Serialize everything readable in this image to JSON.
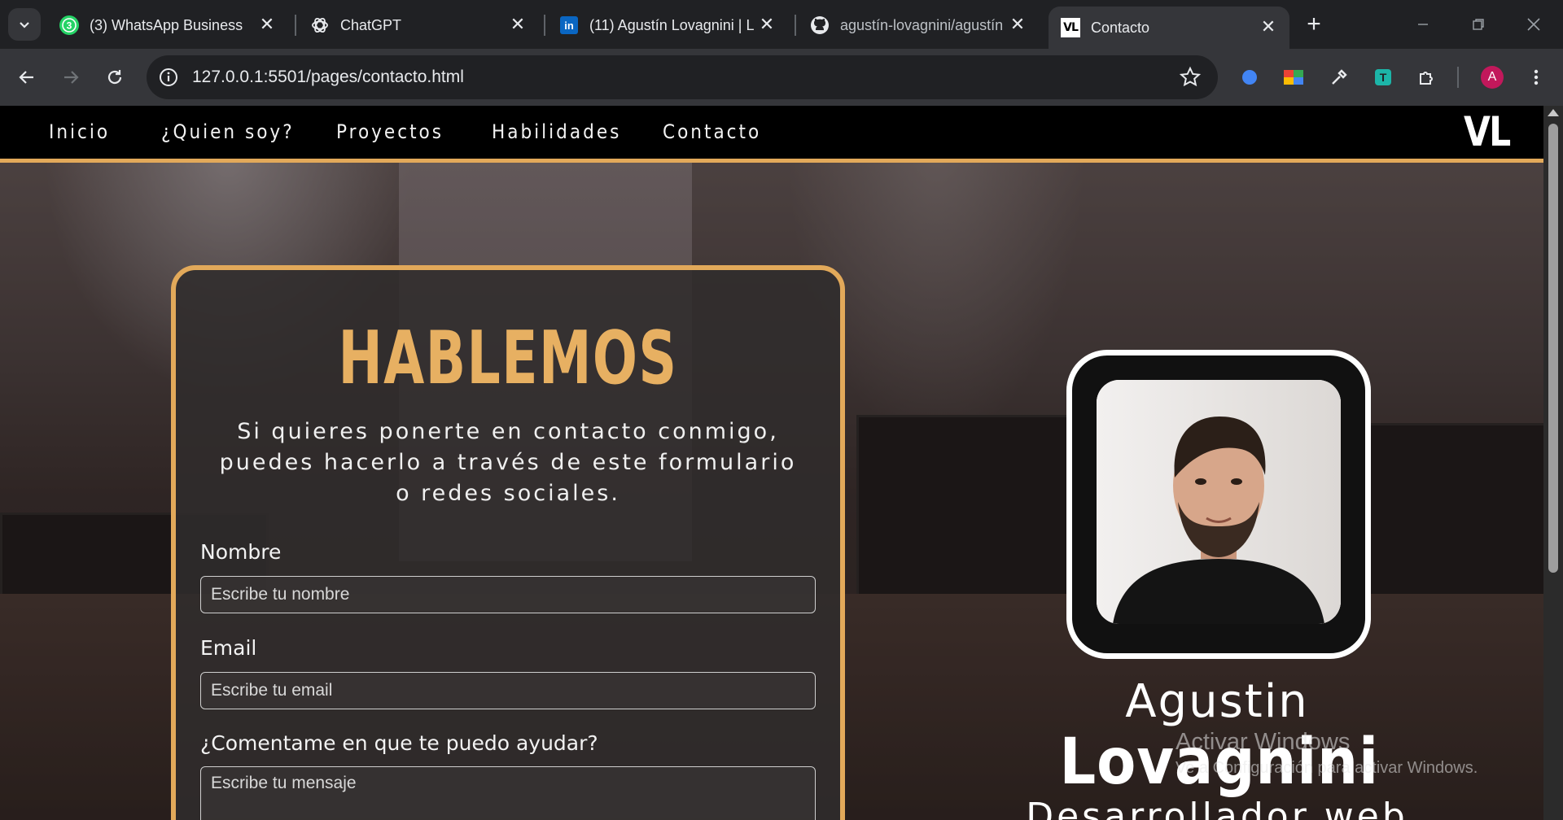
{
  "browser": {
    "tabs": [
      {
        "title": "(3) WhatsApp Business",
        "icon": "whatsapp-icon",
        "badge": "3"
      },
      {
        "title": "ChatGPT",
        "icon": "chatgpt-icon"
      },
      {
        "title": "(11) Agustín Lovagnini | L",
        "icon": "linkedin-icon"
      },
      {
        "title": "agustín-lovagnini/agustín",
        "icon": "github-icon"
      },
      {
        "title": "Contacto",
        "icon": "vl-favicon-icon",
        "favicon_text": "VL",
        "active": true
      }
    ],
    "url": "127.0.0.1:5501/pages/contacto.html",
    "profile_initial": "A"
  },
  "site": {
    "nav": [
      "Inicio",
      "¿Quien soy?",
      "Proyectos",
      "Habilidades",
      "Contacto"
    ],
    "logo": "VL",
    "accent": "#e2a95a"
  },
  "contact": {
    "heading": "HABLEMOS",
    "intro": "Si quieres ponerte en contacto conmigo, puedes hacerlo a través de este formulario o redes sociales.",
    "fields": [
      {
        "label": "Nombre",
        "placeholder": "Escribe tu nombre"
      },
      {
        "label": "Email",
        "placeholder": "Escribe tu email"
      },
      {
        "label": "¿Comentame en que te puedo ayudar?",
        "placeholder": "Escribe tu mensaje"
      }
    ]
  },
  "profile": {
    "first_name": "Agustin",
    "last_name": "Lovagnini",
    "role": "Desarrollador web"
  },
  "watermark": {
    "line1": "Activar Windows",
    "line2": "Ve a Configuración para activar Windows."
  }
}
